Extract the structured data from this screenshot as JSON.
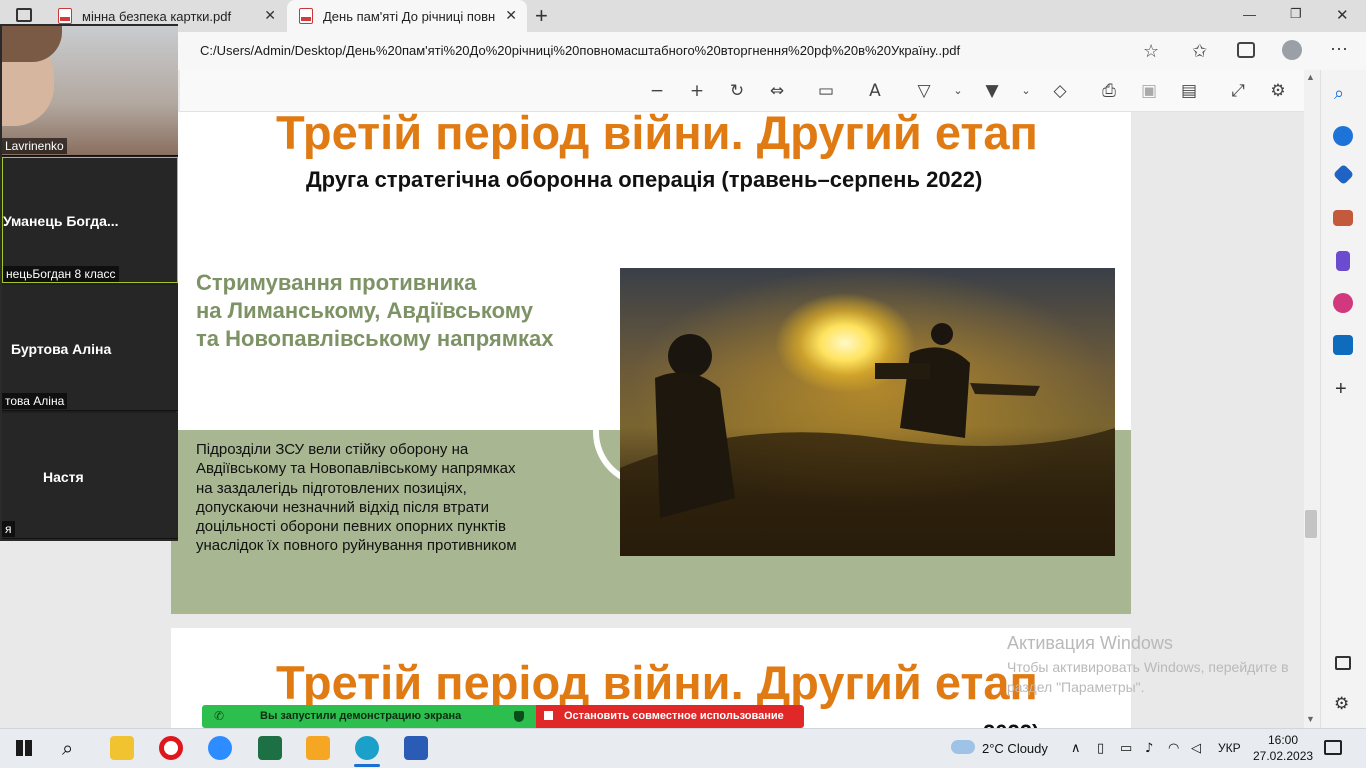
{
  "browser": {
    "tabs": [
      {
        "title": "мінна безпека картки.pdf",
        "active": false
      },
      {
        "title": "День пам'яті До річниці повном",
        "active": true
      }
    ],
    "new_tab": "+",
    "url": "C:/Users/Admin/Desktop/День%20пам'яті%20До%20річниці%20повномасштабного%20вторгнення%20рф%20в%20Україну..pdf",
    "window_controls": {
      "minimize": "—",
      "restore": "❐",
      "close": "✕"
    }
  },
  "pdf": {
    "page1": {
      "title": "Третій період війни. Другий етап",
      "subtitle": "Друга стратегічна оборонна операція (травень–серпень 2022)",
      "heading_lines": [
        "Стримування противника",
        "на Лиманському, Авдіївському",
        "та Новопавлівському напрямках"
      ],
      "body_lines": [
        "Підрозділи ЗСУ вели стійку оборону на",
        "Авдіївському та Новопавлівському напрямках",
        "на заздалегідь підготовлених позиціях,",
        "допускаючи незначний відхід після втрати",
        "доцільності оборони певних опорних пунктів",
        "унаслідок їх повного руйнування противником"
      ]
    },
    "page2": {
      "title": "Третій період війни. Другий етап",
      "subtitle_fragment": "2022)"
    }
  },
  "zoom": {
    "participants": [
      {
        "name": "",
        "label": "Lavrinenko",
        "video": true
      },
      {
        "name": "Уманець  Богда...",
        "label": "нецьБогдан 8 класс",
        "active_speaker": true
      },
      {
        "name": "Буртова Аліна",
        "label": "това Аліна"
      },
      {
        "name": "Настя",
        "label": "я"
      }
    ]
  },
  "share_bar": {
    "message": "Вы запустили демонстрацию экрана",
    "stop": "Остановить совместное использование"
  },
  "activation": {
    "title": "Активация Windows",
    "line1": "Чтобы активировать Windows, перейдите в",
    "line2": "раздел \"Параметры\"."
  },
  "taskbar": {
    "weather": "2°C  Cloudy",
    "language": "УКР",
    "time": "16:00",
    "date": "27.02.2023",
    "apps": [
      "start-icon",
      "search-icon",
      "file-explorer-icon",
      "opera-icon",
      "zoom-icon",
      "excel-icon",
      "media-player-icon",
      "edge-icon",
      "word-icon"
    ]
  },
  "colors": {
    "title_orange": "#e07b14",
    "heading_green": "#7d9265",
    "band_green": "#a9b692",
    "share_green": "#2dbf4d",
    "share_red": "#e02828"
  }
}
